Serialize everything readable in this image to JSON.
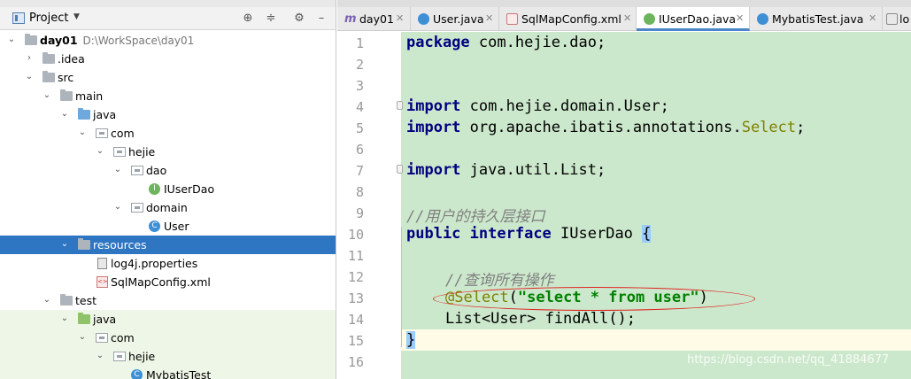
{
  "project_panel": {
    "title": "Project",
    "toolbar_icons": [
      "locate-icon",
      "collapse-icon",
      "gear-icon",
      "minimize-icon"
    ],
    "tree": [
      {
        "label": "day01",
        "path": "D:\\WorkSpace\\day01",
        "bold": true
      },
      {
        "label": ".idea"
      },
      {
        "label": "src"
      },
      {
        "label": "main"
      },
      {
        "label": "java"
      },
      {
        "label": "com"
      },
      {
        "label": "hejie"
      },
      {
        "label": "dao"
      },
      {
        "label": "IUserDao"
      },
      {
        "label": "domain"
      },
      {
        "label": "User"
      },
      {
        "label": "resources"
      },
      {
        "label": "log4j.properties"
      },
      {
        "label": "SqlMapConfig.xml"
      },
      {
        "label": "test"
      },
      {
        "label": "java"
      },
      {
        "label": "com"
      },
      {
        "label": "hejie"
      },
      {
        "label": "MybatisTest"
      }
    ]
  },
  "tabs": [
    {
      "label": "day01",
      "icon": "module-icon"
    },
    {
      "label": "User.java",
      "icon": "class-icon"
    },
    {
      "label": "SqlMapConfig.xml",
      "icon": "xml-icon"
    },
    {
      "label": "IUserDao.java",
      "icon": "interface-icon",
      "active": true
    },
    {
      "label": "MybatisTest.java",
      "icon": "class-icon"
    },
    {
      "label": "lo",
      "icon": "file-icon"
    }
  ],
  "editor": {
    "line_numbers": [
      "1",
      "2",
      "3",
      "4",
      "5",
      "6",
      "7",
      "8",
      "9",
      "10",
      "11",
      "12",
      "13",
      "14",
      "15",
      "16"
    ],
    "lines": {
      "l1_kw": "package",
      "l1_rest": " com.hejie.dao;",
      "l4_kw": "import",
      "l4_rest": " com.hejie.domain.User;",
      "l5_kw": "import",
      "l5_rest": " org.apache.ibatis.annotations.",
      "l5_ann": "Select",
      "l5_end": ";",
      "l7_kw": "import",
      "l7_rest": " java.util.List;",
      "l9_comment": "//用户的持久层接口",
      "l10_kw1": "public",
      "l10_kw2": "interface",
      "l10_name": " IUserDao ",
      "l10_brace": "{",
      "l12_comment": "//查询所有操作",
      "l13_ann": "@Select",
      "l13_open": "(",
      "l13_str": "\"select * from user\"",
      "l13_close": ")",
      "l14": "List<User> findAll();",
      "l15_brace": "}"
    }
  },
  "watermark": "https://blog.csdn.net/qq_41884677",
  "colors": {
    "selection": "#2e75c2",
    "code_bg": "#cce8cc",
    "annotation_circle": "#e02020"
  }
}
